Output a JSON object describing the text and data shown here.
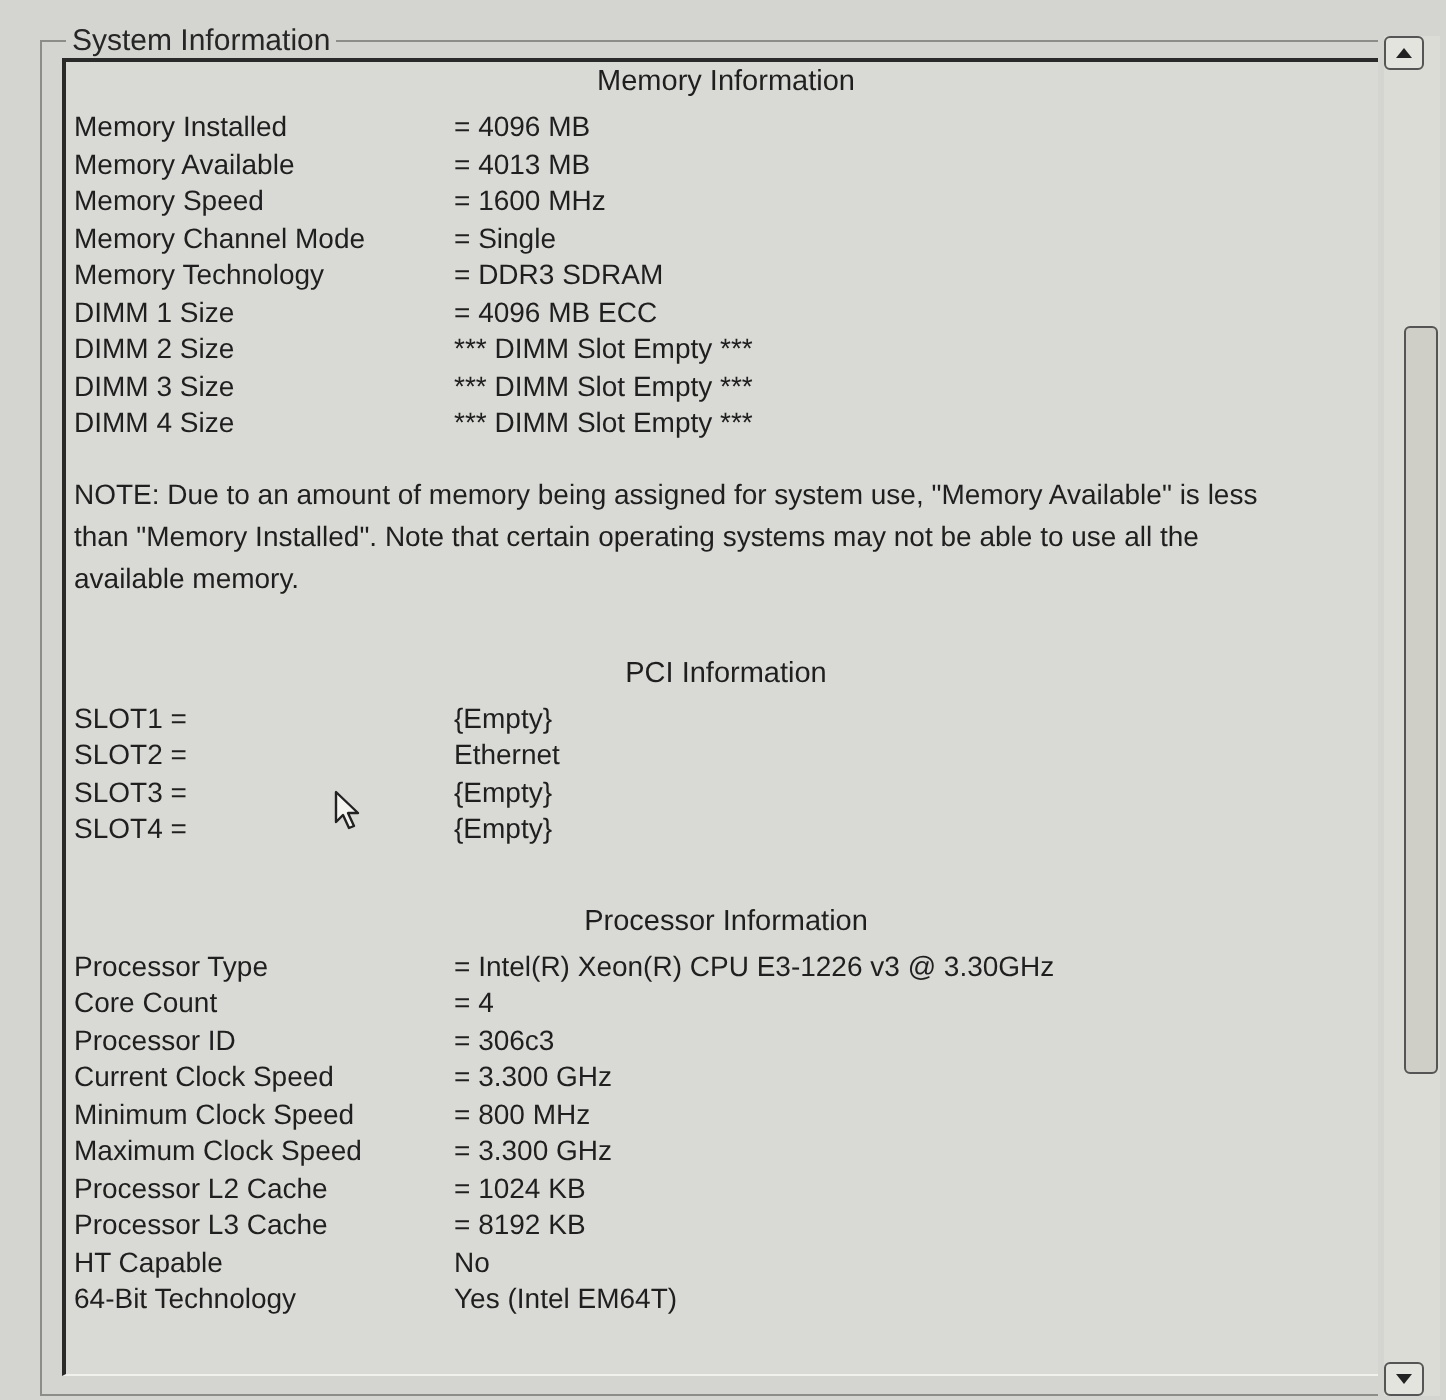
{
  "group": {
    "title": "System Information"
  },
  "sections": [
    {
      "heading": "Memory Information",
      "rows": [
        {
          "label": "Memory Installed",
          "value": "= 4096 MB"
        },
        {
          "label": "Memory Available",
          "value": "= 4013 MB"
        },
        {
          "label": "Memory Speed",
          "value": "= 1600 MHz"
        },
        {
          "label": "Memory Channel Mode",
          "value": "= Single"
        },
        {
          "label": "Memory Technology",
          "value": "= DDR3 SDRAM"
        },
        {
          "label": "DIMM 1 Size",
          "value": "= 4096 MB ECC"
        },
        {
          "label": "DIMM 2 Size",
          "value": "*** DIMM Slot Empty ***"
        },
        {
          "label": "DIMM 3 Size",
          "value": "*** DIMM Slot Empty ***"
        },
        {
          "label": "DIMM 4 Size",
          "value": "*** DIMM Slot Empty ***"
        }
      ],
      "note": "NOTE: Due to an amount of memory being assigned for system use, \"Memory Available\" is less than \"Memory Installed\". Note that certain operating systems may not be able to use all the available memory."
    },
    {
      "heading": "PCI Information",
      "rows": [
        {
          "label": "SLOT1 =",
          "value": "{Empty}"
        },
        {
          "label": "SLOT2 =",
          "value": "Ethernet"
        },
        {
          "label": "SLOT3 =",
          "value": "{Empty}"
        },
        {
          "label": "SLOT4 =",
          "value": "{Empty}"
        }
      ]
    },
    {
      "heading": "Processor Information",
      "rows": [
        {
          "label": "Processor Type",
          "value": "= Intel(R) Xeon(R) CPU E3-1226 v3 @ 3.30GHz"
        },
        {
          "label": "Core Count",
          "value": "= 4"
        },
        {
          "label": "Processor ID",
          "value": "= 306c3"
        },
        {
          "label": "Current Clock Speed",
          "value": "= 3.300 GHz"
        },
        {
          "label": "Minimum Clock Speed",
          "value": "= 800 MHz"
        },
        {
          "label": "Maximum Clock Speed",
          "value": "= 3.300 GHz"
        },
        {
          "label": "Processor L2 Cache",
          "value": "= 1024 KB"
        },
        {
          "label": "Processor L3 Cache",
          "value": "= 8192 KB"
        },
        {
          "label": "HT Capable",
          "value": "No"
        },
        {
          "label": "64-Bit Technology",
          "value": "Yes (Intel EM64T)"
        }
      ]
    }
  ]
}
